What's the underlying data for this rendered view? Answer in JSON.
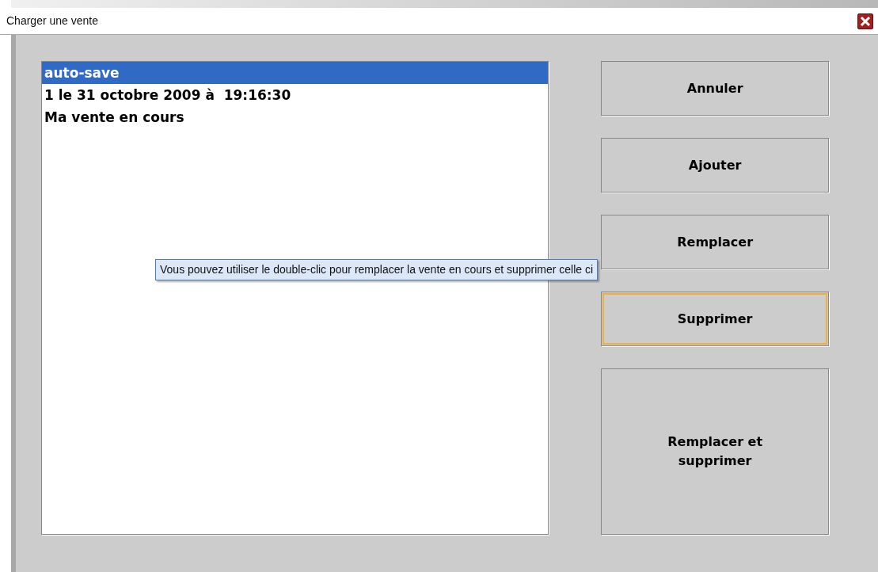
{
  "window": {
    "title": "Charger une vente"
  },
  "list": {
    "items": [
      {
        "label": "auto-save",
        "selected": true
      },
      {
        "label": "1 le 31 octobre 2009 à  19:16:30",
        "selected": false
      },
      {
        "label": "Ma vente en cours",
        "selected": false
      }
    ]
  },
  "buttons": [
    {
      "label": "Annuler",
      "focused": false,
      "kind": "normal"
    },
    {
      "label": "Ajouter",
      "focused": false,
      "kind": "normal"
    },
    {
      "label": "Remplacer",
      "focused": false,
      "kind": "normal"
    },
    {
      "label": "Supprimer",
      "focused": true,
      "kind": "normal"
    },
    {
      "label": "Remplacer et supprimer",
      "focused": false,
      "kind": "tall"
    }
  ],
  "tooltip": {
    "text": "Vous pouvez utiliser le double-clic pour remplacer la vente en cours et supprimer celle ci"
  }
}
